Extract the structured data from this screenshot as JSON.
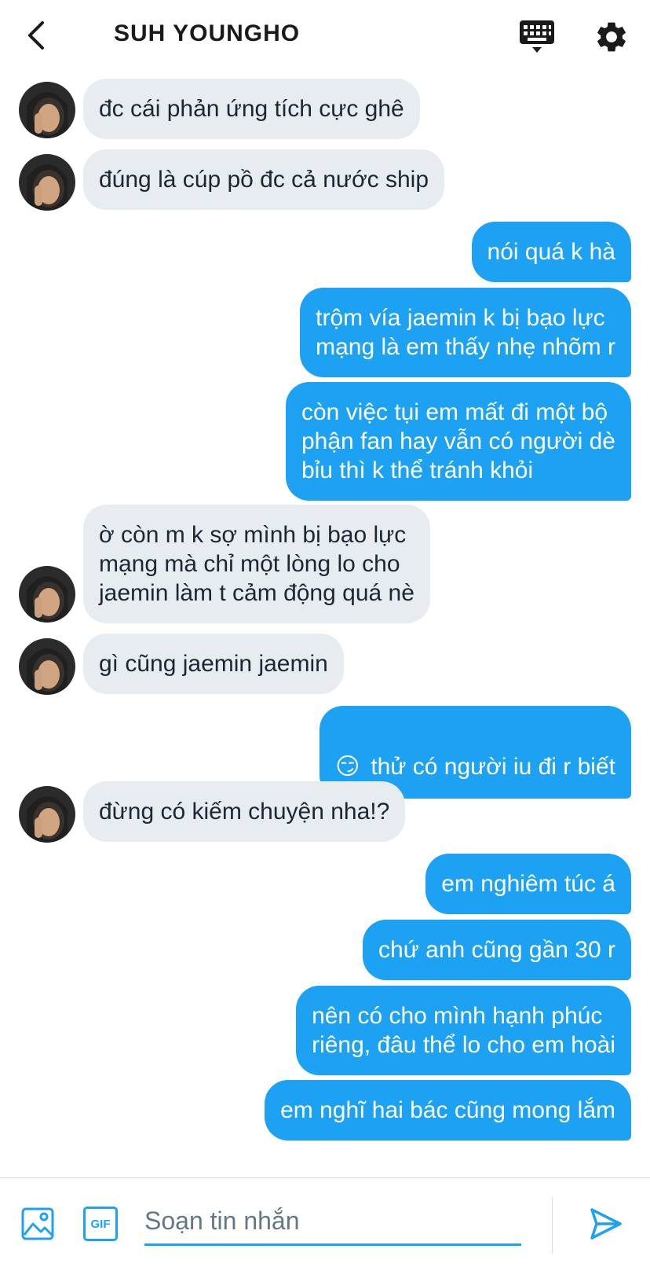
{
  "header": {
    "title": "SUH YOUNGHO"
  },
  "icons": {
    "back": "chevron-left-icon",
    "keyboard": "keyboard-icon",
    "settings": "gear-icon",
    "image": "image-icon",
    "gif": "GIF",
    "send": "send-icon"
  },
  "colors": {
    "accent": "#1da1f2",
    "incoming_bubble": "#e6ecf0",
    "text": "#1c2733"
  },
  "messages": [
    {
      "dir": "in",
      "text": "đc cái phản ứng tích cực ghê",
      "avatar": true
    },
    {
      "dir": "in",
      "text": "đúng là cúp pồ đc cả nước ship",
      "avatar": true
    },
    {
      "dir": "out",
      "text": "nói quá k hà"
    },
    {
      "dir": "out",
      "text": "trộm vía jaemin k bị bạo lực\nmạng là em thấy nhẹ nhõm r"
    },
    {
      "dir": "out",
      "text": "còn việc tụi em mất đi một bộ\nphận fan hay vẫn có người dè\nbỉu thì k thể tránh khỏi"
    },
    {
      "dir": "in",
      "text": "ờ còn m k sợ mình bị bạo lực\nmạng mà chỉ một lòng lo cho\njaemin làm t cảm động quá nè",
      "avatar": true
    },
    {
      "dir": "in",
      "text": "gì cũng jaemin jaemin",
      "avatar": true
    },
    {
      "dir": "out",
      "emoji": "😏",
      "text": "thử có người iu đi r biết"
    },
    {
      "dir": "in",
      "text": "đừng có kiếm chuyện nha!?",
      "avatar": true
    },
    {
      "dir": "out",
      "text": "em nghiêm túc á"
    },
    {
      "dir": "out",
      "text": "chứ anh cũng gần 30 r"
    },
    {
      "dir": "out",
      "text": "nên có cho mình hạnh phúc\nriêng, đâu thể lo cho em hoài"
    },
    {
      "dir": "out",
      "text": "em nghĩ hai bác cũng mong lắm"
    }
  ],
  "composer": {
    "placeholder": "Soạn tin nhắn",
    "gif_label": "GIF"
  }
}
